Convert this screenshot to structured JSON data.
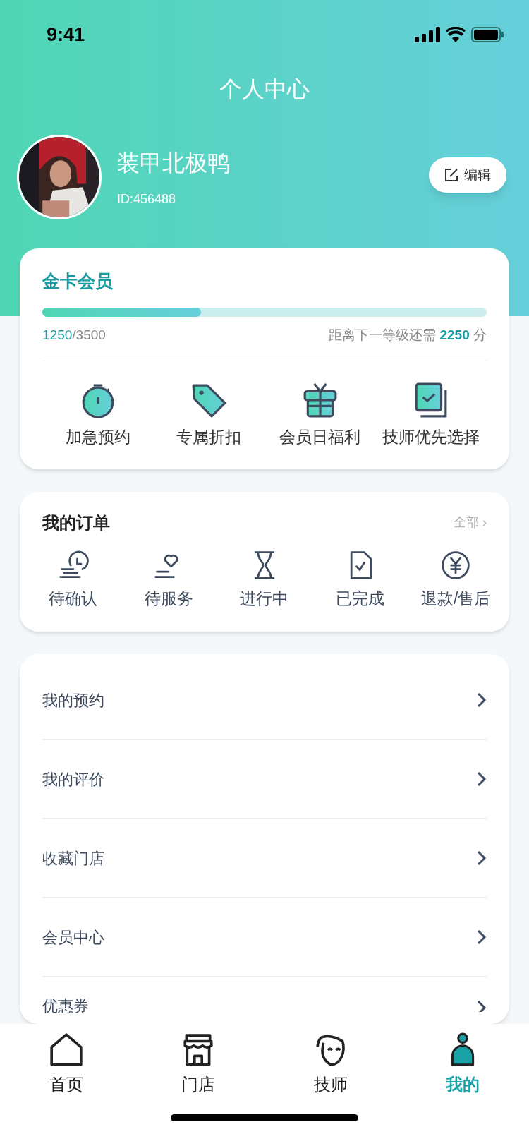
{
  "status_bar": {
    "time": "9:41"
  },
  "header": {
    "title": "个人中心"
  },
  "profile": {
    "name": "装甲北极鸭",
    "id": "ID:456488",
    "edit_button": "编辑"
  },
  "membership": {
    "tier": "金卡会员",
    "level": 0.357,
    "points": "1250",
    "total": "/3500",
    "next_prefix": "距离下一等级还需",
    "next_points": "2250",
    "next_suffix": "分",
    "perks": [
      {
        "kind": "stopwatch",
        "label": "加急预约"
      },
      {
        "kind": "tag",
        "label": "专属折扣"
      },
      {
        "kind": "gift",
        "label": "会员日福利"
      },
      {
        "kind": "check",
        "label": "技师优先选择"
      }
    ]
  },
  "orders": {
    "title": "我的订单",
    "all_link": "全部",
    "chevron": "›",
    "statuses": [
      {
        "kind": "clock",
        "label": "待确认"
      },
      {
        "kind": "heart",
        "label": "待服务"
      },
      {
        "kind": "hourglass",
        "label": "进行中"
      },
      {
        "kind": "file",
        "label": "已完成"
      },
      {
        "kind": "yen",
        "label": "退款/售后"
      }
    ]
  },
  "menu": [
    {
      "label": "我的预约"
    },
    {
      "label": "我的评价"
    },
    {
      "label": "收藏门店"
    },
    {
      "label": "会员中心"
    },
    {
      "label": "优惠券"
    }
  ],
  "tab_bar": [
    {
      "kind": "home",
      "label": "首页",
      "selected": false
    },
    {
      "kind": "store",
      "label": "门店",
      "selected": false
    },
    {
      "kind": "mask",
      "label": "技师",
      "selected": false
    },
    {
      "kind": "person",
      "label": "我的",
      "selected": true
    }
  ]
}
